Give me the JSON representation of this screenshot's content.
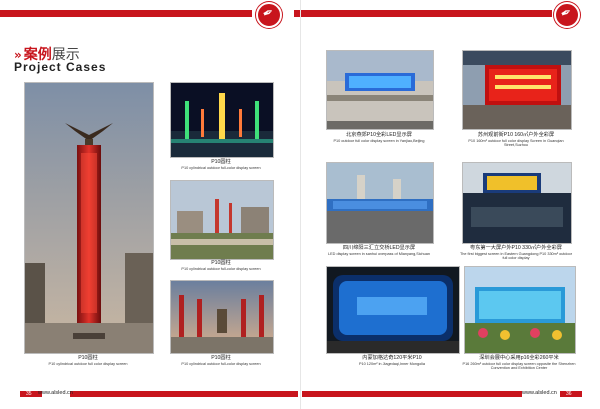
{
  "header": {
    "title_cn_bold": "案例",
    "title_cn_light": "展示",
    "title_en": "Project Cases"
  },
  "cases": {
    "c1": {
      "cn": "P10圆柱",
      "en": "P10 cylindrical outdoor full color display screen"
    },
    "c2": {
      "cn": "P10圆柱",
      "en": "P10 cylindrical outdoor full-color display screen"
    },
    "c3": {
      "cn": "P10圆柱",
      "en": "P10 cylindrical outdoor full-color display screen"
    },
    "c4": {
      "cn": "P10圆柱",
      "en": "P10 cylindrical outdoor full-color display screen"
    },
    "c5": {
      "cn": "北京燕郊P10全彩LED显示屏",
      "en": "P10  outdoor full color display screen in Yanjiao,Beijing"
    },
    "c6": {
      "cn": "苏州观前街P10 160㎡户外全彩屏",
      "en": "P10 160m²  outdoor full color display Screen in Guanqian Street,Suzhou"
    },
    "c7": {
      "cn": "四川绵阳三汇立交桥LED显示屏",
      "en": "LED display screen in sanhui overpass of Mianyang,Sichuan"
    },
    "c8": {
      "cn": "粤东第一大屏户外P10 330㎡户外全彩屏",
      "en": "The first biggest screen in Eastern Guangdong P10 330m²  outdoor full color display"
    },
    "c9": {
      "cn": "内蒙加格达奇120平米P10",
      "en": "P10 120m²  in Jiagedaqi,Inner Mongolia"
    },
    "c10": {
      "cn": "深圳会展中心采用p16全彩260平米",
      "en": "P16 260m²  outdoor full color display screen opposite the Shenzhen Convention and Exhibition Center"
    }
  },
  "footer": {
    "left_page": "35",
    "right_page": "36",
    "url": "www.alsled.cn"
  },
  "colors": {
    "brand_red": "#c8151d"
  },
  "icons": {
    "logo": "pen-nib-logo-icon",
    "heading_arrow": "double-chevron-icon"
  }
}
